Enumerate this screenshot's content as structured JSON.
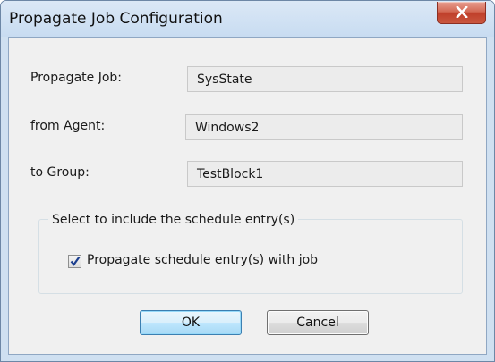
{
  "window": {
    "title": "Propagate Job Configuration"
  },
  "form": {
    "job_label": "Propagate Job:",
    "job_value": "SysState",
    "agent_label": "from Agent:",
    "agent_value": "Windows2",
    "group_label": "to Group:",
    "group_value": "TestBlock1"
  },
  "schedule_group": {
    "legend": "Select to include the schedule entry(s)",
    "checkbox_label": "Propagate schedule entry(s) with job",
    "checked": true
  },
  "buttons": {
    "ok": "OK",
    "cancel": "Cancel"
  },
  "icons": {
    "close": "close-icon",
    "check": "checkmark-icon"
  },
  "colors": {
    "close_button": "#c9573f",
    "ok_border": "#3c7fb1",
    "title_bar": "#cfe0f1"
  }
}
